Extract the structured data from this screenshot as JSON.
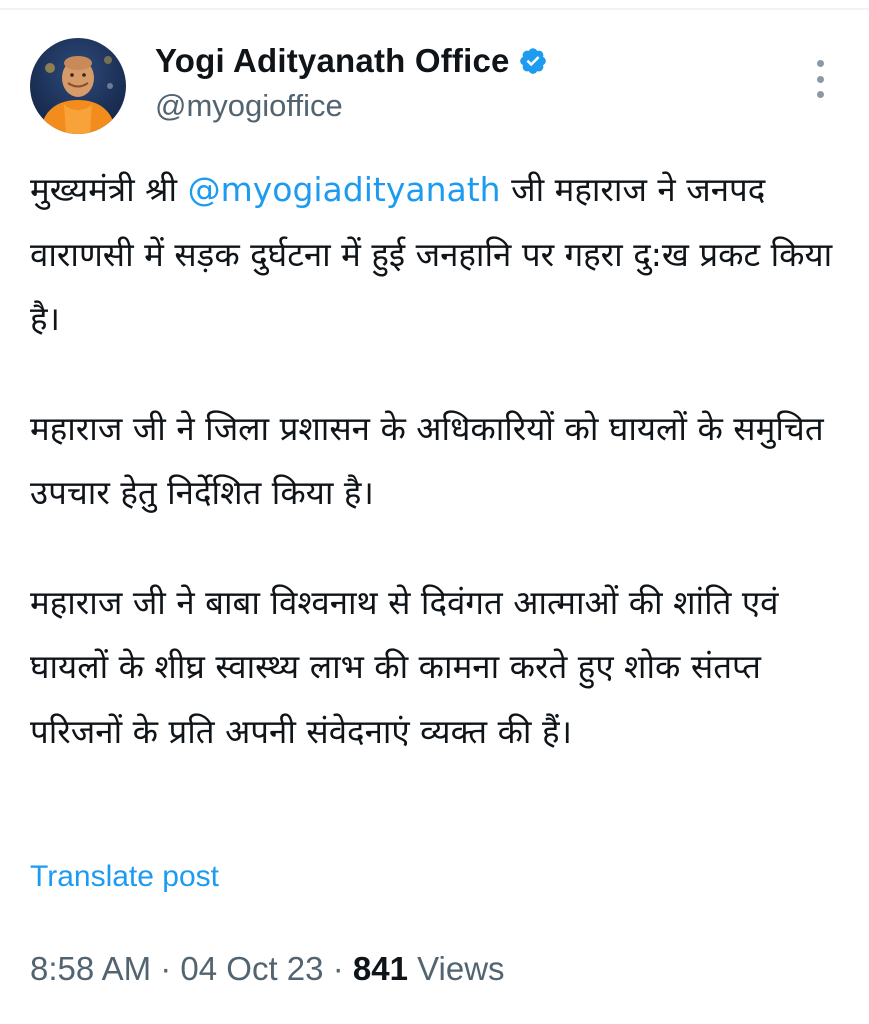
{
  "author": {
    "display_name": "Yogi Adityanath Office",
    "handle": "@myogioffice",
    "verified": true,
    "avatar_icon": "profile-photo-person-in-saffron"
  },
  "tweet": {
    "paragraph1": {
      "prefix": "मुख्यमंत्री श्री ",
      "mention": "@myogiadityanath",
      "suffix": " जी महाराज ने जनपद वाराणसी में सड़क दुर्घटना में हुई जनहानि पर गहरा दु:ख प्रकट किया है।"
    },
    "paragraph2": "महाराज जी ने जिला प्रशासन के अधिकारियों को घायलों के समुचित उपचार हेतु निर्देशित किया है।",
    "paragraph3": "महाराज जी ने बाबा विश्वनाथ से दिवंगत आत्माओं की शांति एवं घायलों के शीघ्र स्वास्थ्य लाभ की कामना करते हुए शोक संतप्त परिजनों के प्रति अपनी संवेदनाएं व्यक्त की हैं।"
  },
  "translate_label": "Translate post",
  "meta": {
    "time": "8:58 AM",
    "separator": "·",
    "date": "04 Oct 23",
    "views_count": "841",
    "views_label": "Views"
  },
  "colors": {
    "link": "#1d9bf0",
    "secondary_text": "#536471",
    "primary_text": "#0f1419"
  }
}
